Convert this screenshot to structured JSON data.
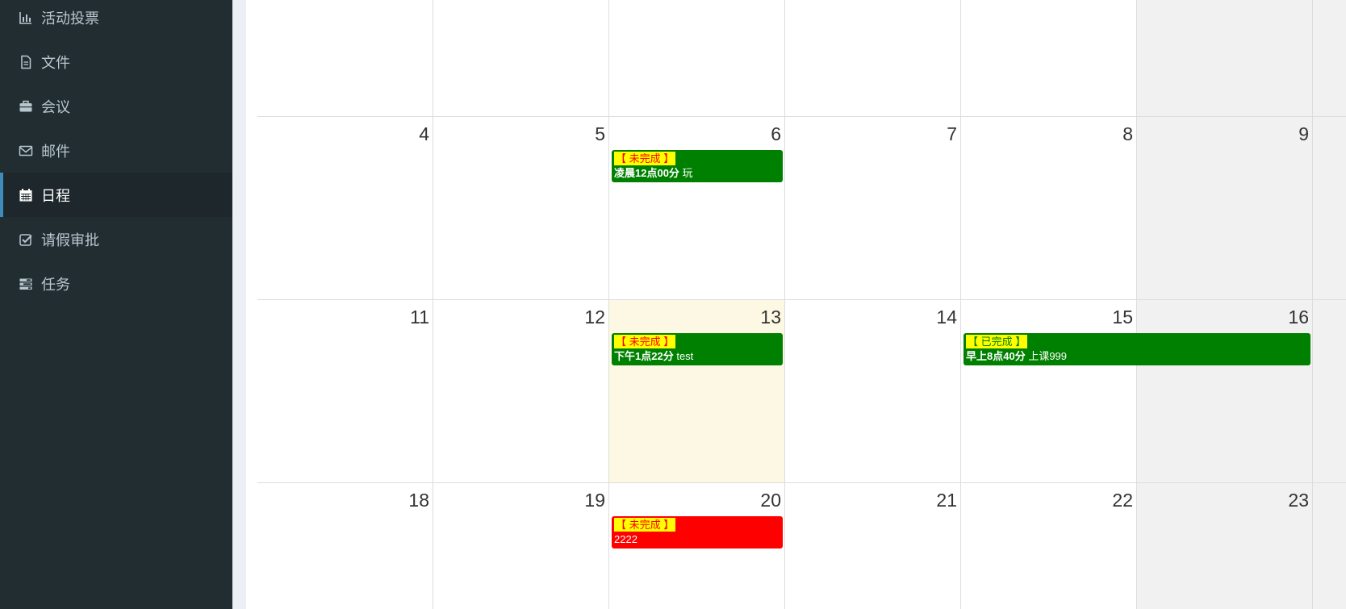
{
  "sidebar": {
    "items": [
      {
        "label": "活动投票",
        "icon": "bar-chart-icon",
        "active": false
      },
      {
        "label": "文件",
        "icon": "file-icon",
        "active": false
      },
      {
        "label": "会议",
        "icon": "briefcase-icon",
        "active": false
      },
      {
        "label": "邮件",
        "icon": "envelope-icon",
        "active": false
      },
      {
        "label": "日程",
        "icon": "calendar-icon",
        "active": true
      },
      {
        "label": "请假审批",
        "icon": "check-square-icon",
        "active": false
      },
      {
        "label": "任务",
        "icon": "tasks-icon",
        "active": false
      }
    ]
  },
  "calendar": {
    "colors": {
      "green": "#008000",
      "red": "#ff0000",
      "today": "#fcf8e3",
      "weekend": "#f1f1f1"
    },
    "weeks": [
      {
        "days": [
          "",
          "",
          "",
          "",
          "",
          "",
          ""
        ]
      },
      {
        "days": [
          "4",
          "5",
          "6",
          "7",
          "8",
          "9",
          ""
        ]
      },
      {
        "days": [
          "11",
          "12",
          "13",
          "14",
          "15",
          "16",
          ""
        ]
      },
      {
        "days": [
          "18",
          "19",
          "20",
          "21",
          "22",
          "23",
          ""
        ]
      }
    ],
    "events": [
      {
        "status": "【 未完成 】",
        "time": "凌晨12点00分",
        "title": "玩",
        "color": "green"
      },
      {
        "status": "【 未完成 】",
        "time": "下午1点22分",
        "title": "test",
        "color": "green"
      },
      {
        "status": "【 已完成 】",
        "time": "早上8点40分",
        "title": "上课999",
        "color": "green"
      },
      {
        "status": "【 未完成 】",
        "time": "",
        "title": "2222",
        "color": "red"
      }
    ]
  }
}
